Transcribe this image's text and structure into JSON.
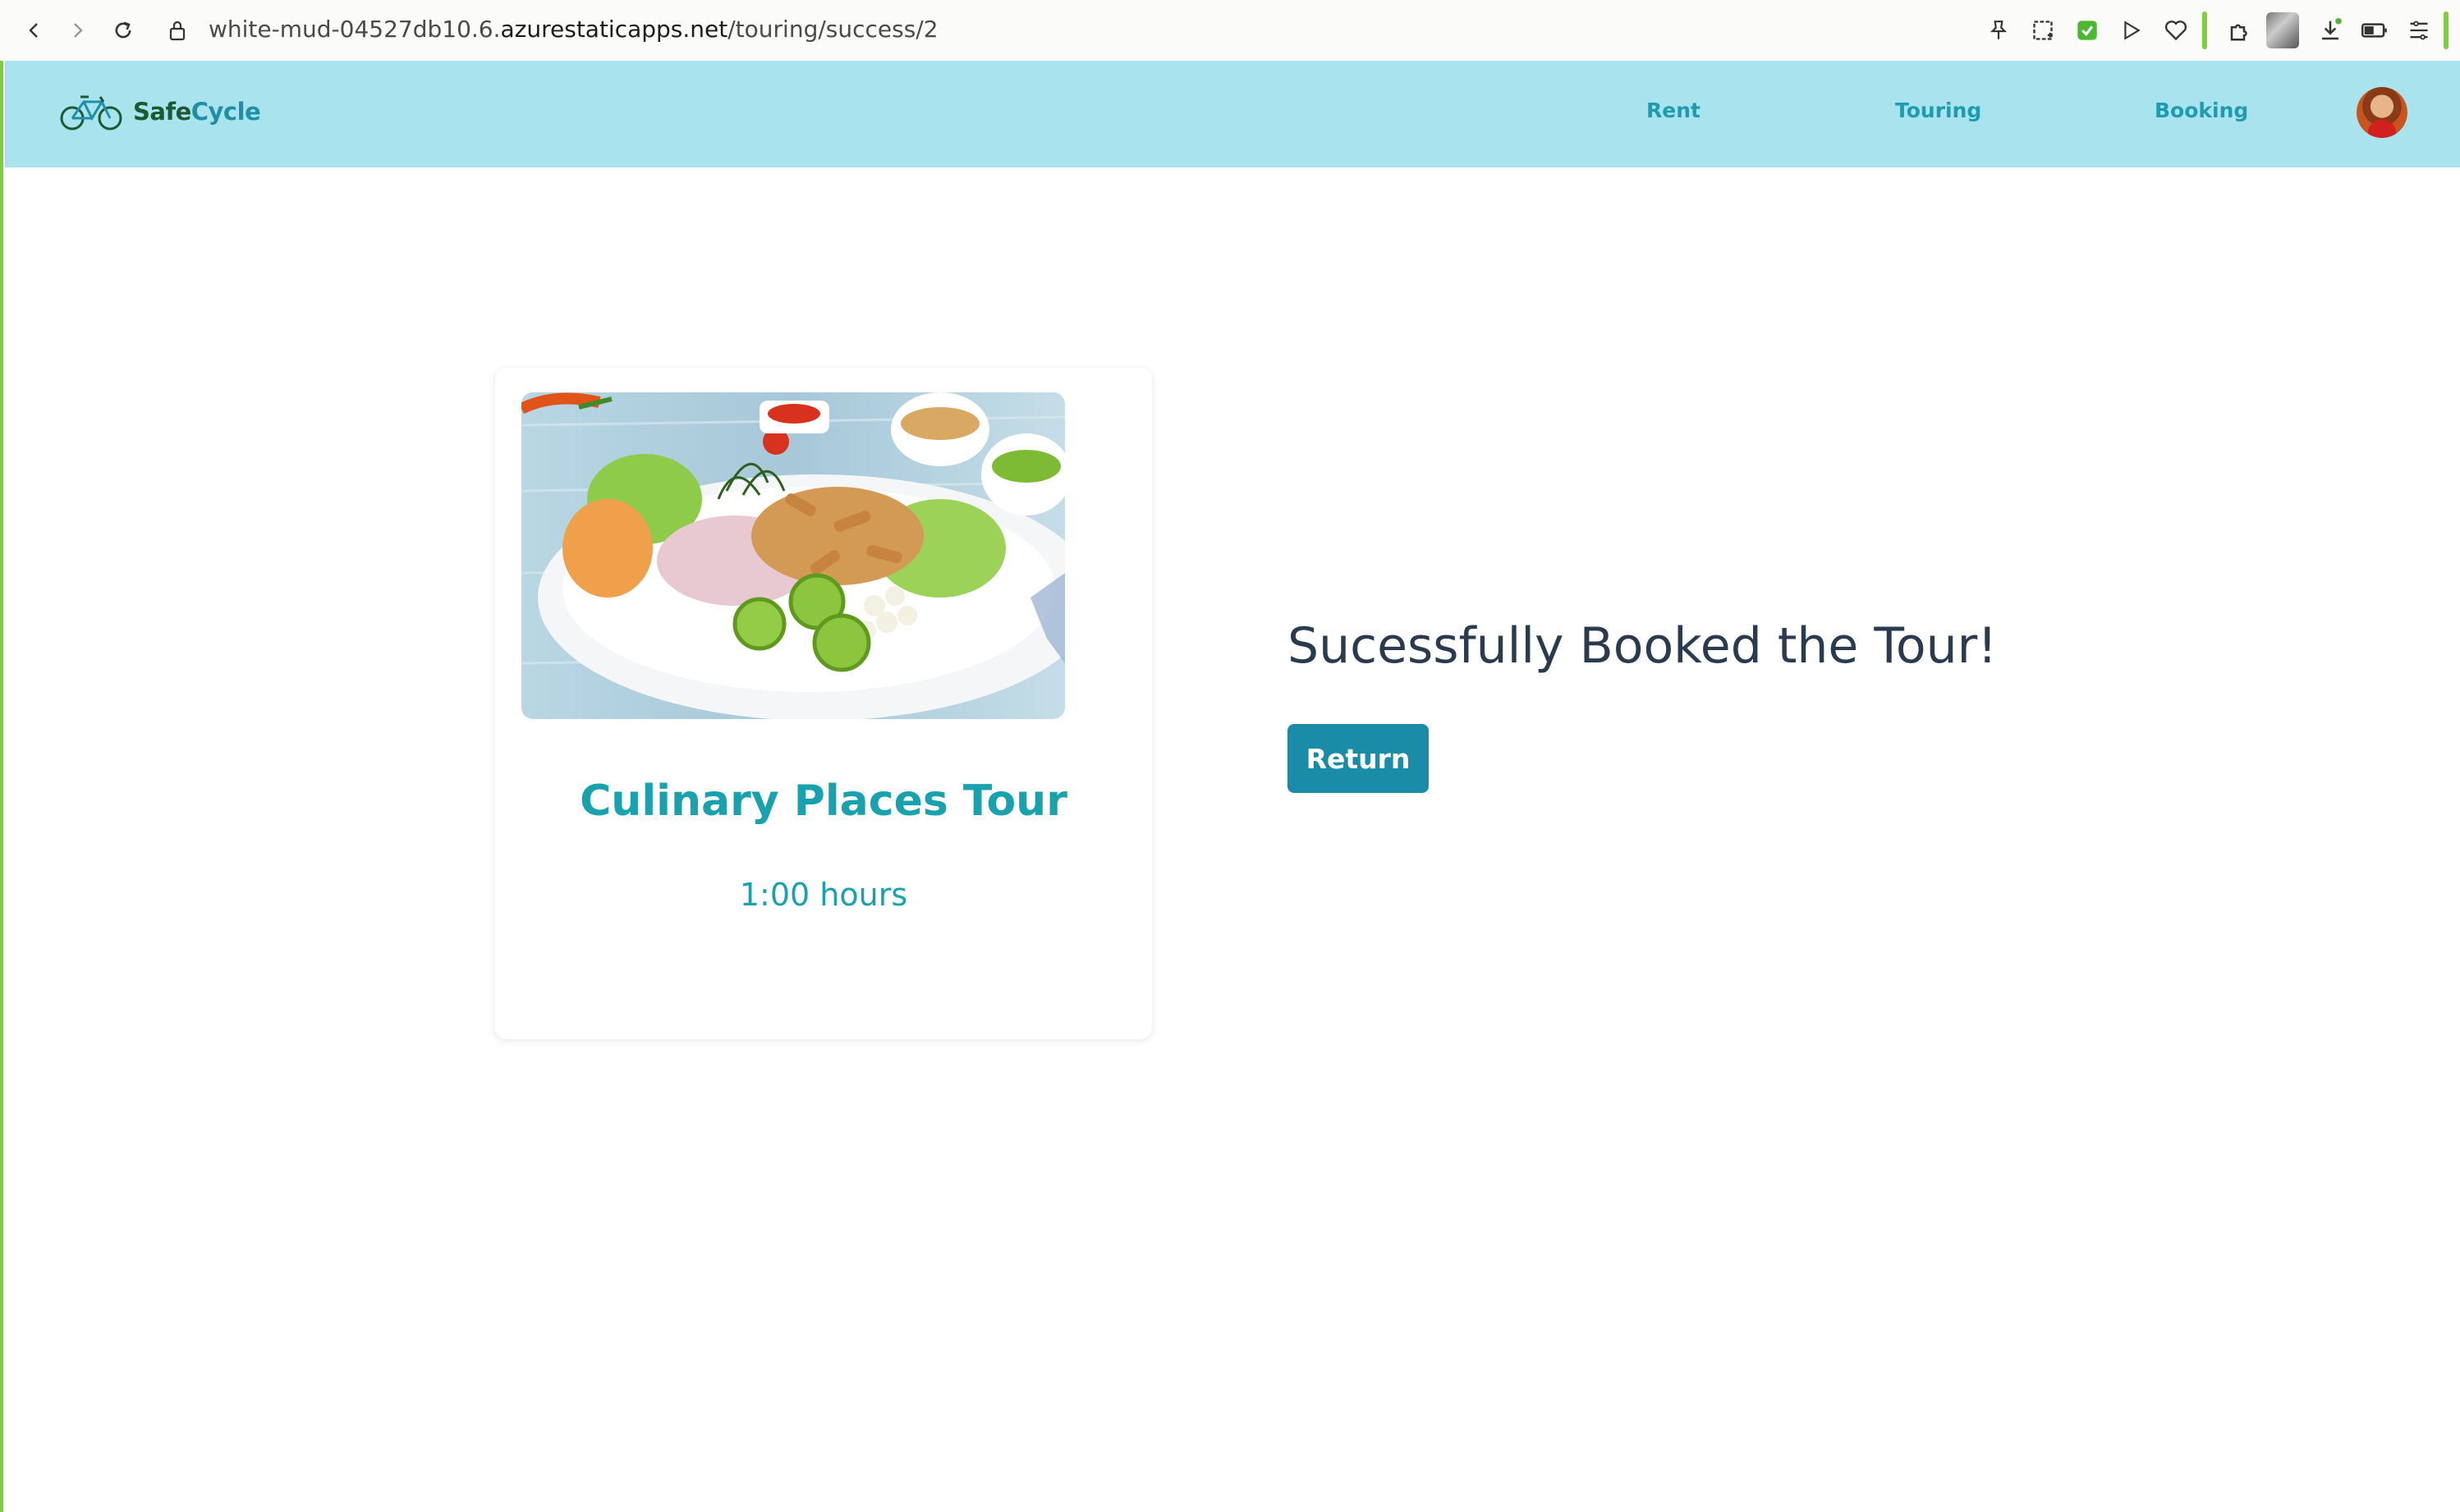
{
  "browser": {
    "url_prefix": "white-mud-04527db10.6.",
    "url_host": "azurestaticapps.net",
    "url_path": "/touring/success/2"
  },
  "navbar": {
    "brand_safe": "Safe",
    "brand_cycle": "Cycle",
    "links": [
      "Rent",
      "Touring",
      "Booking"
    ]
  },
  "tour_card": {
    "title": "Culinary Places Tour",
    "duration": "1:00 hours",
    "image_alt": "Plate of ceviche with fried seafood, lime and lettuce"
  },
  "confirmation": {
    "message": "Sucessfully Booked the Tour!",
    "return_label": "Return"
  },
  "colors": {
    "navbar_bg": "#a8e3ee",
    "accent": "#17a2ae",
    "button": "#1a8ca8"
  }
}
